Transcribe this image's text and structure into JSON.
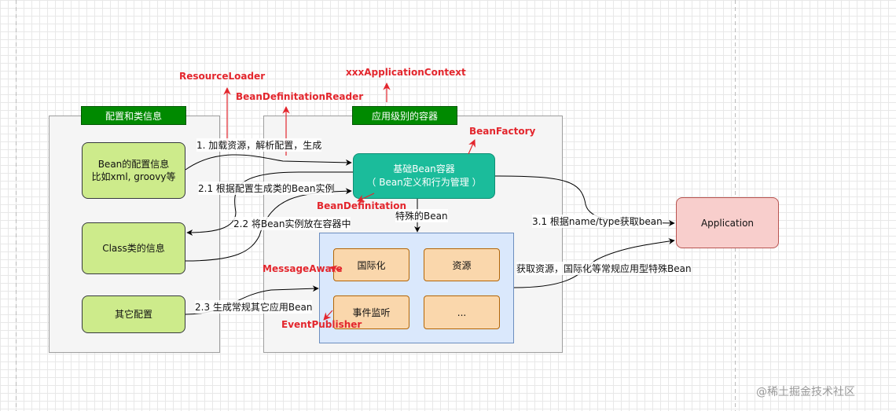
{
  "groups": {
    "config_info": "配置和类信息",
    "app_container": "应用级别的容器"
  },
  "nodes": {
    "bean_config_line1": "Bean的配置信息",
    "bean_config_line2": "比如xml, groovy等",
    "class_info": "Class类的信息",
    "other_config": "其它配置",
    "bean_container_line1": "基础Bean容器",
    "bean_container_line2": "（ Bean定义和行为管理 ）",
    "i18n": "国际化",
    "resource": "资源",
    "event_listener": "事件监听",
    "ellipsis": "...",
    "application": "Application"
  },
  "edges": {
    "load_resource": "1. 加载资源，解析配置，生成",
    "gen_instance": "2.1  根据配置生成类的Bean实例",
    "put_container": "2.2 将Bean实例放在容器中",
    "gen_regular": "2.3 生成常规其它应用Bean",
    "special_bean": "特殊的Bean",
    "get_bean": "3.1 根据name/type获取bean",
    "get_resource": "获取资源，国际化等常规应用型特殊Bean"
  },
  "annotations": {
    "resource_loader": "ResourceLoader",
    "definition_reader": "BeanDefinitationReader",
    "app_context": "xxxApplicationContext",
    "bean_factory": "BeanFactory",
    "bean_definition": "BeanDefinitation",
    "message_aware": "MessageAware",
    "event_publisher": "EventPublisher"
  },
  "watermark": "@稀土掘金技术社区",
  "colors": {
    "accent_red": "#e3262d",
    "group_green": "#008a00",
    "lime": "#cdeb8b",
    "teal": "#1bbc9b",
    "light_blue": "#dae8fc",
    "orange": "#fad7ac",
    "pink": "#f8cecc"
  }
}
